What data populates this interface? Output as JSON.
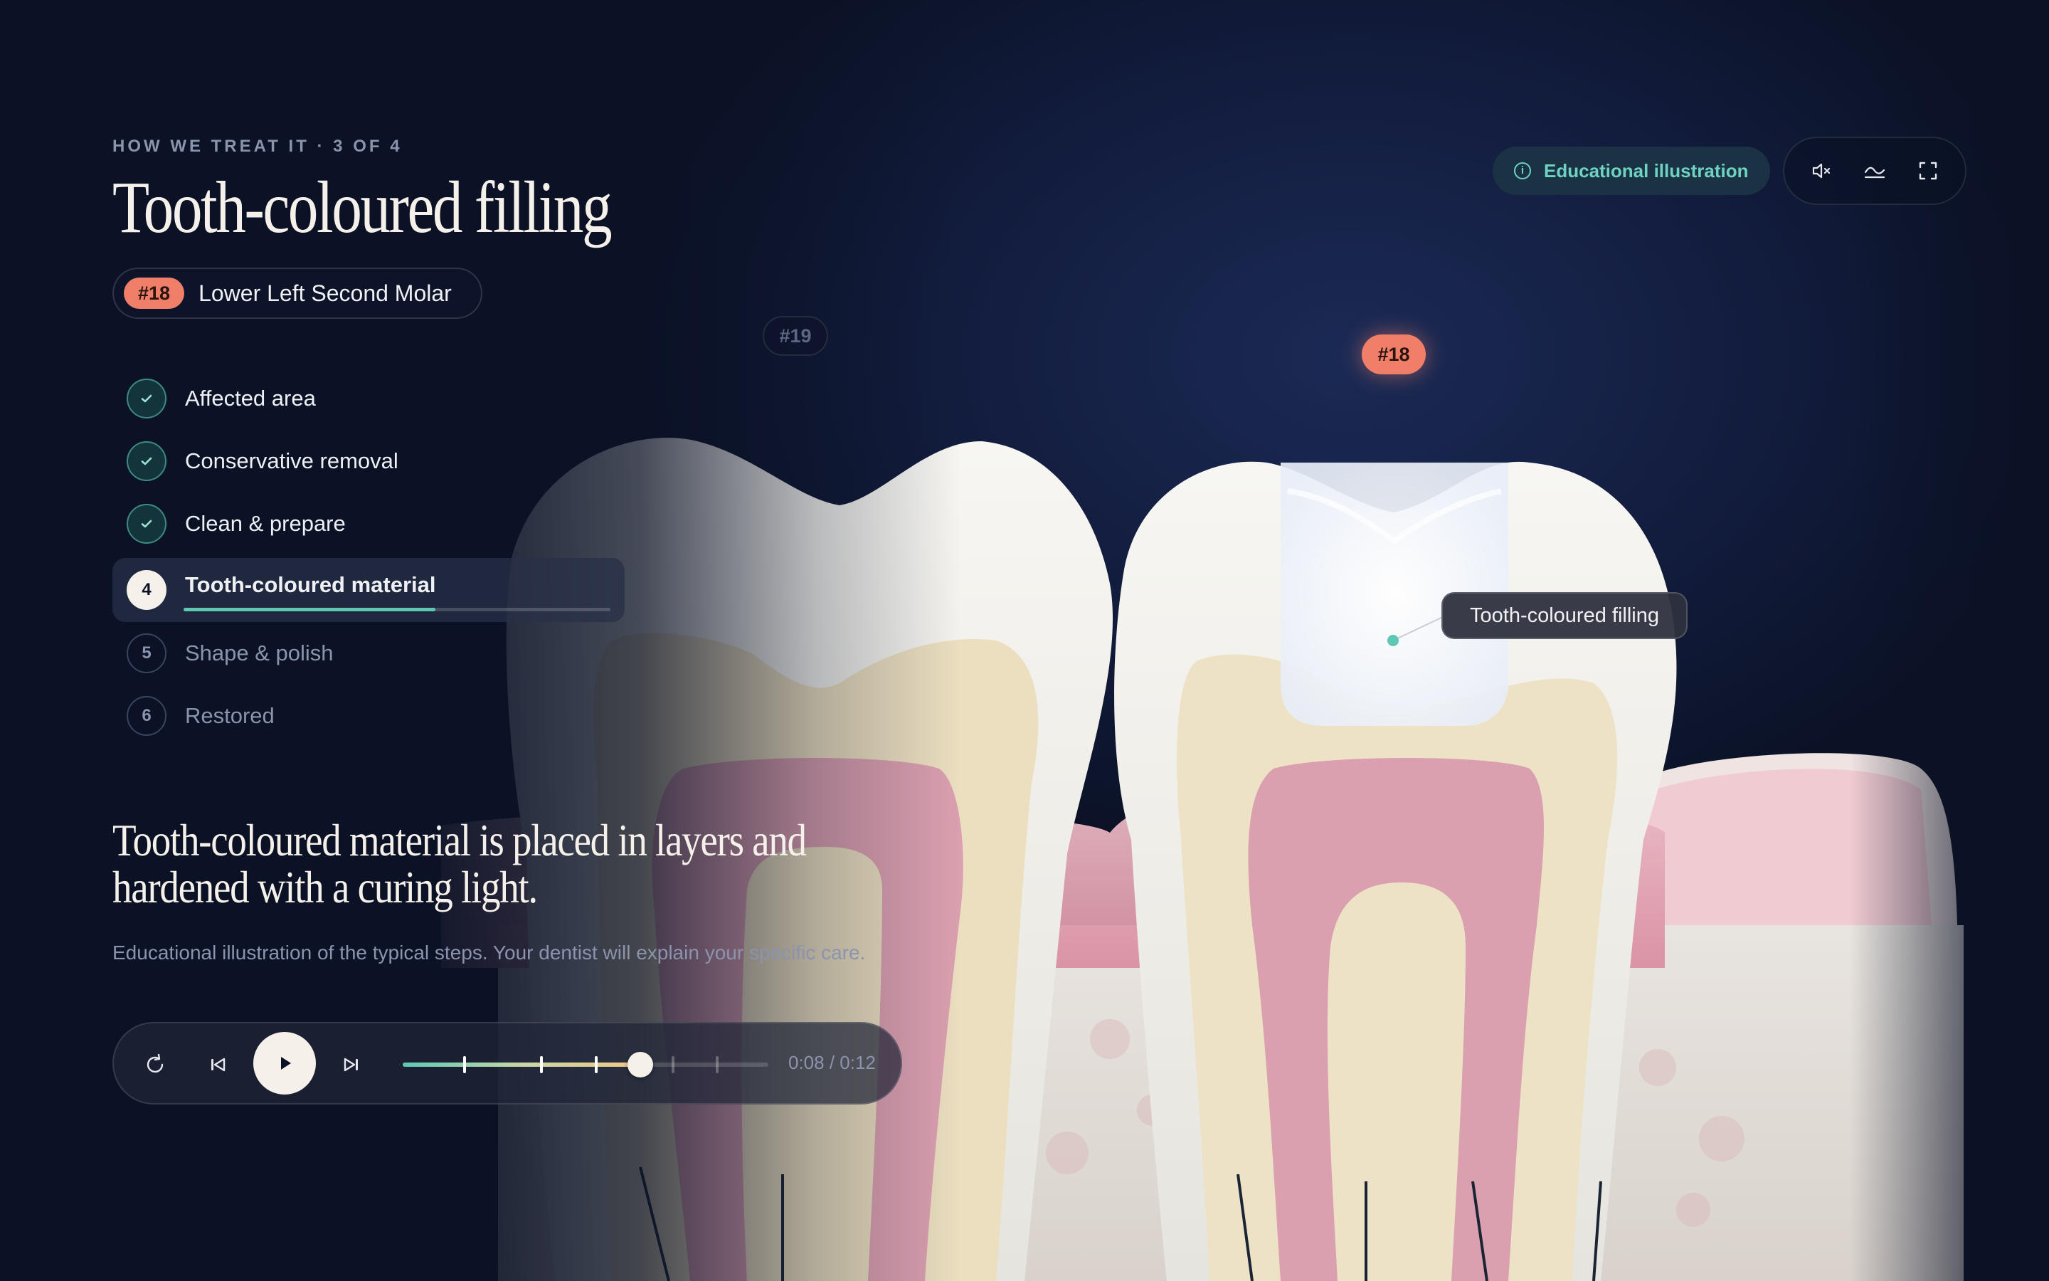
{
  "header": {
    "eyebrow": "HOW WE TREAT IT · 3 OF 4",
    "title": "Tooth-coloured filling",
    "tooth_number": "#18",
    "tooth_name": "Lower Left Second Molar"
  },
  "top_right": {
    "badge_label": "Educational illustration",
    "badge_icon": "info-icon",
    "controls": [
      {
        "name": "mute",
        "icon": "speaker-muted-icon"
      },
      {
        "name": "motion",
        "icon": "wave-icon"
      },
      {
        "name": "fullscreen",
        "icon": "fullscreen-icon"
      }
    ]
  },
  "steps": [
    {
      "number": "1",
      "label": "Affected area",
      "state": "done"
    },
    {
      "number": "2",
      "label": "Conservative removal",
      "state": "done"
    },
    {
      "number": "3",
      "label": "Clean & prepare",
      "state": "done"
    },
    {
      "number": "4",
      "label": "Tooth-coloured material",
      "state": "active",
      "progress": 0.59
    },
    {
      "number": "5",
      "label": "Shape & polish",
      "state": "todo"
    },
    {
      "number": "6",
      "label": "Restored",
      "state": "todo"
    }
  ],
  "caption": {
    "headline": "Tooth-coloured material is placed in layers and hardened with a curing light.",
    "note": "Educational illustration of the typical steps. Your dentist will explain your specific care."
  },
  "player": {
    "time": "0:08 / 0:12",
    "progress": 0.65,
    "step_markers": [
      0.17,
      0.38,
      0.53,
      0.74,
      0.86
    ],
    "buttons": [
      "replay-icon",
      "previous-icon",
      "play-icon",
      "next-icon"
    ]
  },
  "illustration": {
    "neighbor_tag": "#19",
    "focus_tag": "#18",
    "callout": "Tooth-coloured filling"
  },
  "colors": {
    "accent_teal": "#5ec8b5",
    "accent_coral": "#f07f69",
    "background": "#0b1226",
    "text_cream": "#f5f1ea",
    "muted": "#8b93ad"
  }
}
